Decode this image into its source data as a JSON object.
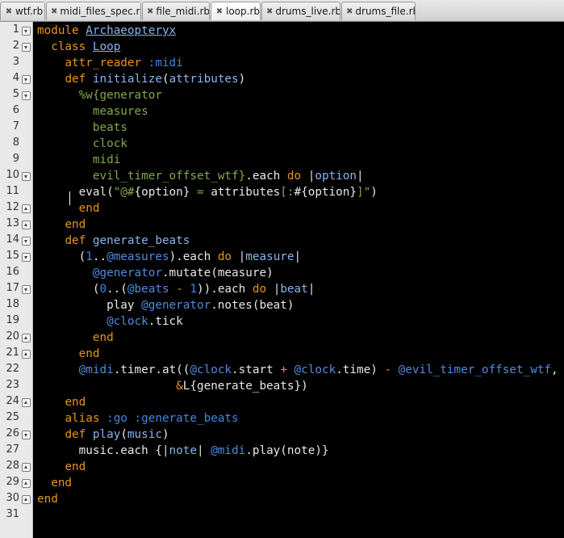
{
  "tabs": [
    {
      "label": "wtf.rb",
      "active": false
    },
    {
      "label": "midi_files_spec.rb",
      "active": false
    },
    {
      "label": "file_midi.rb",
      "active": false
    },
    {
      "label": "loop.rb",
      "active": true
    },
    {
      "label": "drums_live.rb",
      "active": false
    },
    {
      "label": "drums_file.rb",
      "active": false
    }
  ],
  "colors": {
    "keyword": "#e8951f",
    "class_name": "#89b4ee",
    "symbol": "#3e87e3",
    "method_name": "#89b4ee",
    "instance_var": "#4f8be0",
    "string": "#82a84a",
    "plain": "#e8e8e8",
    "background": "#000000",
    "gutter": "#e9e9e9"
  },
  "code": {
    "lines": [
      {
        "n": "1",
        "fold": "start",
        "tokens": [
          [
            "kw",
            "module "
          ],
          [
            "cls",
            "Archaeopteryx"
          ]
        ]
      },
      {
        "n": "2",
        "fold": "start",
        "tokens": [
          [
            "plain",
            "  "
          ],
          [
            "kw",
            "class "
          ],
          [
            "cls",
            "Loop"
          ]
        ]
      },
      {
        "n": "3",
        "fold": "",
        "tokens": [
          [
            "plain",
            "    "
          ],
          [
            "kw",
            "attr_reader "
          ],
          [
            "sym",
            ":midi"
          ]
        ]
      },
      {
        "n": "4",
        "fold": "start",
        "tokens": [
          [
            "plain",
            "    "
          ],
          [
            "kw",
            "def "
          ],
          [
            "fn",
            "initialize"
          ],
          [
            "plain",
            "("
          ],
          [
            "fn",
            "attributes"
          ],
          [
            "plain",
            ")"
          ]
        ]
      },
      {
        "n": "5",
        "fold": "start",
        "tokens": [
          [
            "plain",
            "      "
          ],
          [
            "str",
            "%w{generator"
          ]
        ]
      },
      {
        "n": "6",
        "fold": "",
        "tokens": [
          [
            "plain",
            "        "
          ],
          [
            "str",
            "measures"
          ]
        ]
      },
      {
        "n": "7",
        "fold": "",
        "tokens": [
          [
            "plain",
            "        "
          ],
          [
            "str",
            "beats"
          ]
        ]
      },
      {
        "n": "8",
        "fold": "",
        "tokens": [
          [
            "plain",
            "        "
          ],
          [
            "str",
            "clock"
          ]
        ]
      },
      {
        "n": "9",
        "fold": "",
        "tokens": [
          [
            "plain",
            "        "
          ],
          [
            "str",
            "midi"
          ]
        ]
      },
      {
        "n": "10",
        "fold": "start",
        "tokens": [
          [
            "plain",
            "        "
          ],
          [
            "str",
            "evil_timer_offset_wtf}"
          ],
          [
            "plain",
            ".each "
          ],
          [
            "kw",
            "do "
          ],
          [
            "pipe",
            "|"
          ],
          [
            "fn",
            "option"
          ],
          [
            "pipe",
            "|"
          ]
        ]
      },
      {
        "n": "11",
        "fold": "",
        "tokens": [
          [
            "plain",
            "      eval("
          ],
          [
            "str",
            "\"@#"
          ],
          [
            "plain",
            "{option} "
          ],
          [
            "str",
            "= "
          ],
          [
            "plain",
            "attributes"
          ],
          [
            "str",
            "[:"
          ],
          [
            "plain",
            "#{option}"
          ],
          [
            "str",
            "]\""
          ],
          [
            "plain",
            ")"
          ]
        ]
      },
      {
        "n": "12",
        "fold": "end",
        "tokens": [
          [
            "plain",
            "      "
          ],
          [
            "kw",
            "end"
          ]
        ]
      },
      {
        "n": "13",
        "fold": "end",
        "tokens": [
          [
            "plain",
            "    "
          ],
          [
            "kw",
            "end"
          ]
        ]
      },
      {
        "n": "14",
        "fold": "start",
        "tokens": [
          [
            "plain",
            "    "
          ],
          [
            "kw",
            "def "
          ],
          [
            "fn",
            "generate_beats"
          ]
        ]
      },
      {
        "n": "15",
        "fold": "start",
        "tokens": [
          [
            "plain",
            "      ("
          ],
          [
            "sym",
            "1"
          ],
          [
            "plain",
            ".."
          ],
          [
            "ivar",
            "@measures"
          ],
          [
            "plain",
            ").each "
          ],
          [
            "kw",
            "do "
          ],
          [
            "pipe",
            "|"
          ],
          [
            "fn",
            "measure"
          ],
          [
            "pipe",
            "|"
          ]
        ]
      },
      {
        "n": "16",
        "fold": "",
        "tokens": [
          [
            "plain",
            "        "
          ],
          [
            "ivar",
            "@generator"
          ],
          [
            "plain",
            ".mutate(measure)"
          ]
        ]
      },
      {
        "n": "17",
        "fold": "start",
        "tokens": [
          [
            "plain",
            "        ("
          ],
          [
            "sym",
            "0"
          ],
          [
            "plain",
            ".."
          ],
          [
            "plain",
            "("
          ],
          [
            "ivar",
            "@beats"
          ],
          [
            "kw",
            " - "
          ],
          [
            "sym",
            "1"
          ],
          [
            "plain",
            "))"
          ],
          [
            "plain",
            ".each "
          ],
          [
            "kw",
            "do "
          ],
          [
            "pipe",
            "|"
          ],
          [
            "fn",
            "beat"
          ],
          [
            "pipe",
            "|"
          ]
        ]
      },
      {
        "n": "18",
        "fold": "",
        "tokens": [
          [
            "plain",
            "          play "
          ],
          [
            "ivar",
            "@generator"
          ],
          [
            "plain",
            ".notes(beat)"
          ]
        ]
      },
      {
        "n": "19",
        "fold": "",
        "tokens": [
          [
            "plain",
            "          "
          ],
          [
            "ivar",
            "@clock"
          ],
          [
            "plain",
            ".tick"
          ]
        ]
      },
      {
        "n": "20",
        "fold": "end",
        "tokens": [
          [
            "plain",
            "        "
          ],
          [
            "kw",
            "end"
          ]
        ]
      },
      {
        "n": "21",
        "fold": "end",
        "tokens": [
          [
            "plain",
            "      "
          ],
          [
            "kw",
            "end"
          ]
        ]
      },
      {
        "n": "22",
        "fold": "",
        "tokens": [
          [
            "plain",
            "      "
          ],
          [
            "ivar",
            "@midi"
          ],
          [
            "plain",
            ".timer.at(("
          ],
          [
            "ivar",
            "@clock"
          ],
          [
            "plain",
            ".start "
          ],
          [
            "kw",
            "+ "
          ],
          [
            "ivar",
            "@clock"
          ],
          [
            "plain",
            ".time) "
          ],
          [
            "kw",
            "- "
          ],
          [
            "ivar",
            "@evil_timer_offset_wtf"
          ],
          [
            "plain",
            ","
          ]
        ]
      },
      {
        "n": "23",
        "fold": "",
        "tokens": [
          [
            "plain",
            "                    "
          ],
          [
            "kw",
            "&"
          ],
          [
            "plain",
            "L{generate_beats})"
          ]
        ]
      },
      {
        "n": "24",
        "fold": "end",
        "tokens": [
          [
            "plain",
            "    "
          ],
          [
            "kw",
            "end"
          ]
        ]
      },
      {
        "n": "25",
        "fold": "",
        "tokens": [
          [
            "plain",
            "    "
          ],
          [
            "kw",
            "alias "
          ],
          [
            "sym",
            ":go :generate_beats"
          ]
        ]
      },
      {
        "n": "26",
        "fold": "start",
        "tokens": [
          [
            "plain",
            "    "
          ],
          [
            "kw",
            "def "
          ],
          [
            "fn",
            "play"
          ],
          [
            "plain",
            "("
          ],
          [
            "fn",
            "music"
          ],
          [
            "plain",
            ")"
          ]
        ]
      },
      {
        "n": "27",
        "fold": "",
        "tokens": [
          [
            "plain",
            "      music.each {"
          ],
          [
            "pipe",
            "|"
          ],
          [
            "fn",
            "note"
          ],
          [
            "pipe",
            "| "
          ],
          [
            "ivar",
            "@midi"
          ],
          [
            "plain",
            ".play(note)}"
          ]
        ]
      },
      {
        "n": "28",
        "fold": "end",
        "tokens": [
          [
            "plain",
            "    "
          ],
          [
            "kw",
            "end"
          ]
        ]
      },
      {
        "n": "29",
        "fold": "end",
        "tokens": [
          [
            "plain",
            "  "
          ],
          [
            "kw",
            "end"
          ]
        ]
      },
      {
        "n": "30",
        "fold": "end",
        "tokens": [
          [
            "kw",
            "end"
          ]
        ]
      },
      {
        "n": "31",
        "fold": "",
        "tokens": []
      }
    ]
  }
}
